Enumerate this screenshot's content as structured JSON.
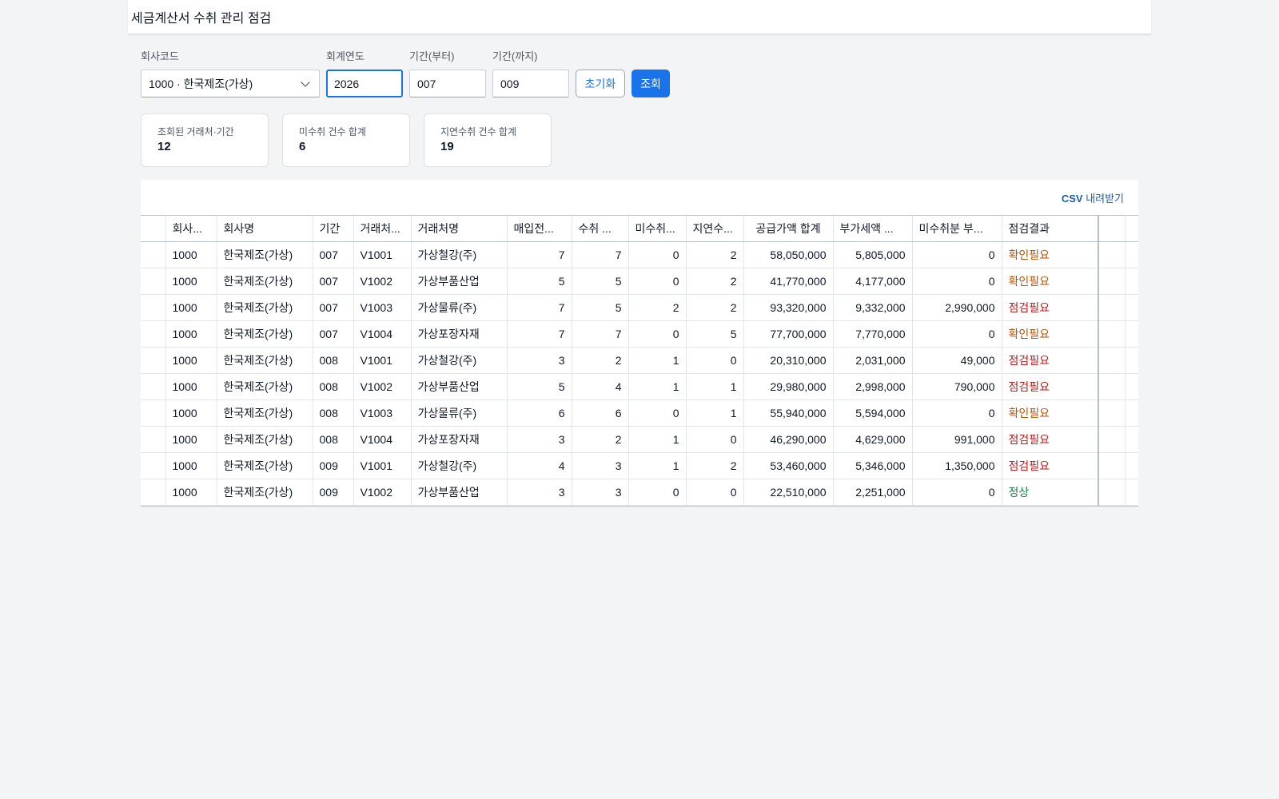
{
  "header": {
    "title": "세금계산서 수취 관리 점검"
  },
  "filters": {
    "company_label": "회사코드",
    "company_value": "1000 · 한국제조(가상)",
    "year_label": "회계연도",
    "year_value": "2026",
    "from_label": "기간(부터)",
    "from_value": "007",
    "to_label": "기간(까지)",
    "to_value": "009",
    "reset_label": "초기화",
    "search_label": "조회"
  },
  "summary": [
    {
      "label": "조회된 거래처·기간",
      "value": "12"
    },
    {
      "label": "미수취 건수 합계",
      "value": "6"
    },
    {
      "label": "지연수취 건수 합계",
      "value": "19"
    }
  ],
  "grid": {
    "csv_prefix": "CSV",
    "csv_suffix": " 내려받기",
    "columns": [
      "회사...",
      "회사명",
      "기간",
      "거래처...",
      "거래처명",
      "매입전...",
      "수취 ...",
      "미수취...",
      "지연수...",
      "공급가액 합계",
      "부가세액 ...",
      "미수취분 부...",
      "점검결과"
    ],
    "rows": [
      [
        "1000",
        "한국제조(가상)",
        "007",
        "V1001",
        "가상철강(주)",
        "7",
        "7",
        "0",
        "2",
        "58,050,000",
        "5,805,000",
        "0",
        "확인필요"
      ],
      [
        "1000",
        "한국제조(가상)",
        "007",
        "V1002",
        "가상부품산업",
        "5",
        "5",
        "0",
        "2",
        "41,770,000",
        "4,177,000",
        "0",
        "확인필요"
      ],
      [
        "1000",
        "한국제조(가상)",
        "007",
        "V1003",
        "가상물류(주)",
        "7",
        "5",
        "2",
        "2",
        "93,320,000",
        "9,332,000",
        "2,990,000",
        "점검필요"
      ],
      [
        "1000",
        "한국제조(가상)",
        "007",
        "V1004",
        "가상포장자재",
        "7",
        "7",
        "0",
        "5",
        "77,700,000",
        "7,770,000",
        "0",
        "확인필요"
      ],
      [
        "1000",
        "한국제조(가상)",
        "008",
        "V1001",
        "가상철강(주)",
        "3",
        "2",
        "1",
        "0",
        "20,310,000",
        "2,031,000",
        "49,000",
        "점검필요"
      ],
      [
        "1000",
        "한국제조(가상)",
        "008",
        "V1002",
        "가상부품산업",
        "5",
        "4",
        "1",
        "1",
        "29,980,000",
        "2,998,000",
        "790,000",
        "점검필요"
      ],
      [
        "1000",
        "한국제조(가상)",
        "008",
        "V1003",
        "가상물류(주)",
        "6",
        "6",
        "0",
        "1",
        "55,940,000",
        "5,594,000",
        "0",
        "확인필요"
      ],
      [
        "1000",
        "한국제조(가상)",
        "008",
        "V1004",
        "가상포장자재",
        "3",
        "2",
        "1",
        "0",
        "46,290,000",
        "4,629,000",
        "991,000",
        "점검필요"
      ],
      [
        "1000",
        "한국제조(가상)",
        "009",
        "V1001",
        "가상철강(주)",
        "4",
        "3",
        "1",
        "2",
        "53,460,000",
        "5,346,000",
        "1,350,000",
        "점검필요"
      ],
      [
        "1000",
        "한국제조(가상)",
        "009",
        "V1002",
        "가상부품산업",
        "3",
        "3",
        "0",
        "0",
        "22,510,000",
        "2,251,000",
        "0",
        "정상"
      ]
    ],
    "status_colors": {
      "확인필요": "#b45309",
      "점검필요": "#b91c1c",
      "정상": "#15803d"
    }
  }
}
